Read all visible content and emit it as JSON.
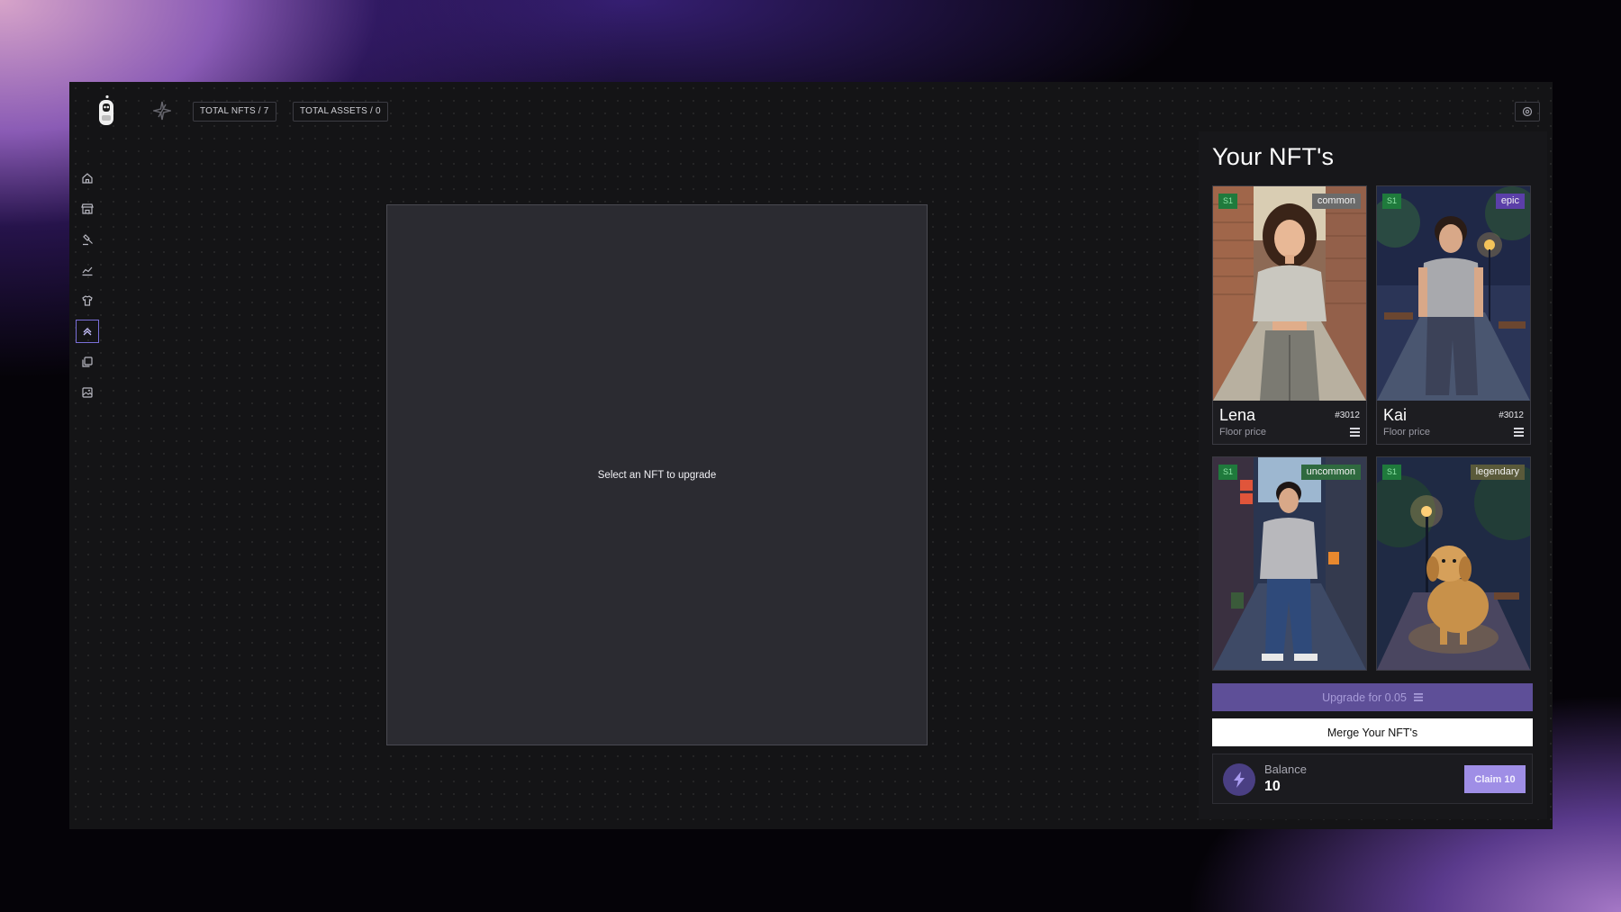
{
  "header": {
    "total_nfts": "TOTAL NFTS / 7",
    "total_assets": "TOTAL ASSETS / 0"
  },
  "sidebar": {
    "items": [
      {
        "icon": "home-icon",
        "active": false
      },
      {
        "icon": "store-icon",
        "active": false
      },
      {
        "icon": "auction-hammer-icon",
        "active": false
      },
      {
        "icon": "chart-icon",
        "active": false
      },
      {
        "icon": "shirt-icon",
        "active": false
      },
      {
        "icon": "upgrade-chevron-icon",
        "active": true
      },
      {
        "icon": "collection-icon",
        "active": false
      },
      {
        "icon": "gallery-icon",
        "active": false
      }
    ]
  },
  "upgrade_area": {
    "placeholder": "Select an NFT to upgrade"
  },
  "panel": {
    "title": "Your NFT's",
    "cards": [
      {
        "name": "Lena",
        "season": "S1",
        "rarity": "common",
        "rarity_color": "#6b6b6b",
        "number": "#3012",
        "floor_label": "Floor price"
      },
      {
        "name": "Kai",
        "season": "S1",
        "rarity": "epic",
        "rarity_color": "#5b3fa8",
        "number": "#3012",
        "floor_label": "Floor price"
      },
      {
        "name": "",
        "season": "S1",
        "rarity": "uncommon",
        "rarity_color": "#2f6a3f"
      },
      {
        "name": "",
        "season": "S1",
        "rarity": "legendary",
        "rarity_color": "#5a5a3a"
      }
    ],
    "upgrade_button": "Upgrade for 0.05",
    "merge_button": "Merge Your NFT's",
    "balance": {
      "label": "Balance",
      "value": "10",
      "claim_button": "Claim 10"
    }
  },
  "colors": {
    "accent": "#7a6fd8",
    "upgrade_bg": "#5e4f98",
    "claim_bg": "#9f8ee6",
    "season_badge": "#1f7a3c"
  }
}
